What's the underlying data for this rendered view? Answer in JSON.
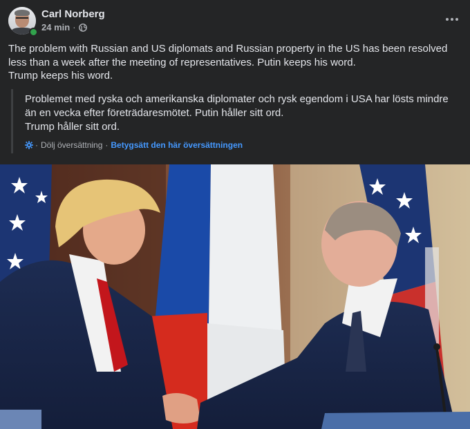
{
  "post": {
    "author": "Carl Norberg",
    "time": "24 min",
    "separator": "·",
    "privacy_icon": "globe-icon",
    "menu_icon": "more-horizontal-icon",
    "text_lines": [
      "The problem with Russian and US diplomats and Russian property in the US has been resolved",
      "less than a week after the meeting of representatives. Putin keeps his word.",
      "Trump keeps his word."
    ],
    "translation": {
      "lines": [
        "Problemet med ryska och amerikanska diplomater och rysk egendom i USA har lösts mindre",
        "än en vecka efter företrädaresmötet. Putin håller sitt ord.",
        "Trump håller sitt ord."
      ],
      "settings_icon": "gear-icon",
      "hide_label": "Dölj översättning",
      "rate_label": "Betygsätt den här översättningen",
      "separator": "·"
    },
    "image_icon": "photo"
  },
  "colors": {
    "background": "#242526",
    "primary_text": "#e4e6eb",
    "secondary_text": "#b0b3b8",
    "link": "#4599ff",
    "online": "#31a24c"
  }
}
